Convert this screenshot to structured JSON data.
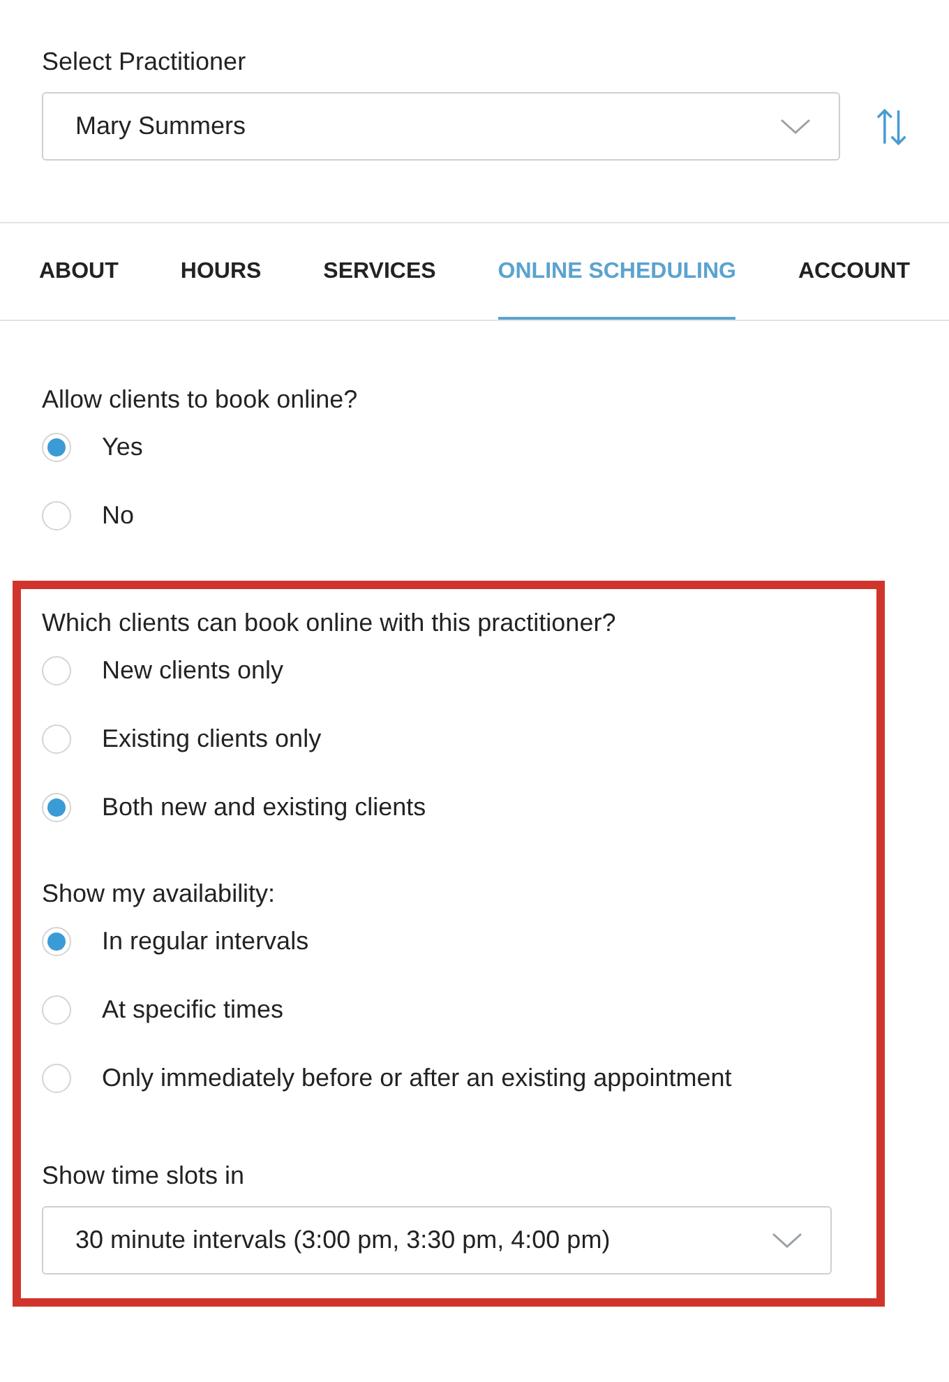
{
  "practitioner": {
    "label": "Select Practitioner",
    "value": "Mary Summers"
  },
  "tabs": [
    {
      "label": "ABOUT",
      "selected": false
    },
    {
      "label": "HOURS",
      "selected": false
    },
    {
      "label": "SERVICES",
      "selected": false
    },
    {
      "label": "ONLINE SCHEDULING",
      "selected": true
    },
    {
      "label": "ACCOUNT",
      "selected": false
    }
  ],
  "allow_online": {
    "question": "Allow clients to book online?",
    "options": [
      {
        "label": "Yes",
        "selected": true
      },
      {
        "label": "No",
        "selected": false
      }
    ]
  },
  "highlighted_section": {
    "questions": [
      {
        "question": "Which clients can book online with this practitioner?",
        "options": [
          {
            "label": "New clients only",
            "selected": false
          },
          {
            "label": "Existing clients only",
            "selected": false
          },
          {
            "label": "Both new and existing clients",
            "selected": true
          }
        ]
      },
      {
        "question": "Show my availability:",
        "options": [
          {
            "label": "In regular intervals",
            "selected": true
          },
          {
            "label": "At specific times",
            "selected": false
          },
          {
            "label": "Only immediately before or after an existing appointment",
            "selected": false
          }
        ]
      }
    ],
    "time_slots": {
      "label": "Show time slots in",
      "value": "30 minute intervals (3:00 pm, 3:30 pm, 4:00 pm)"
    }
  }
}
